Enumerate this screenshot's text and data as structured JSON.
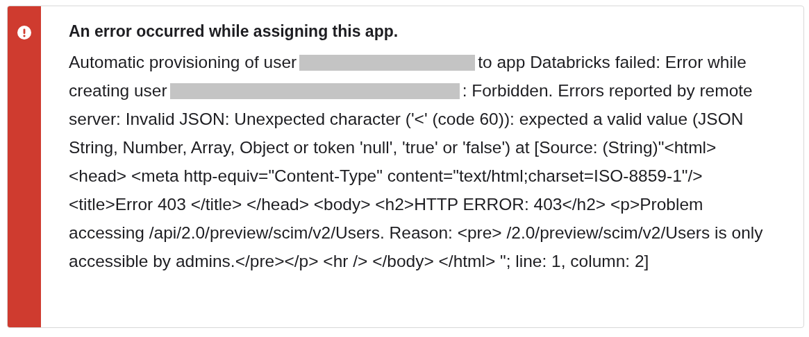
{
  "alert": {
    "title": "An error occurred while assigning this app.",
    "message": [
      {
        "kind": "text",
        "text": "Automatic provisioning of user"
      },
      {
        "kind": "redacted"
      },
      {
        "kind": "text",
        "text": "to app Databricks failed: Error while creating user"
      },
      {
        "kind": "redacted"
      },
      {
        "kind": "text",
        "text": ": Forbidden. Errors reported by remote server: Invalid JSON: Unexpected character ('<' (code 60)): expected a valid value (JSON String, Number, Array, Object or token 'null', 'true' or 'false') at [Source: (String)\"<html> <head> <meta http-equiv=\"Content-Type\" content=\"text/html;charset=ISO-8859-1\"/> <title>Error 403 </title> </head> <body> <h2>HTTP ERROR: 403</h2> <p>Problem accessing /api/2.0/preview/scim/v2/Users. Reason: <pre> /2.0/preview/scim/v2/Users is only accessible by admins.</pre></p> <hr /> </body> </html> \"; line: 1, column: 2]"
      }
    ]
  }
}
